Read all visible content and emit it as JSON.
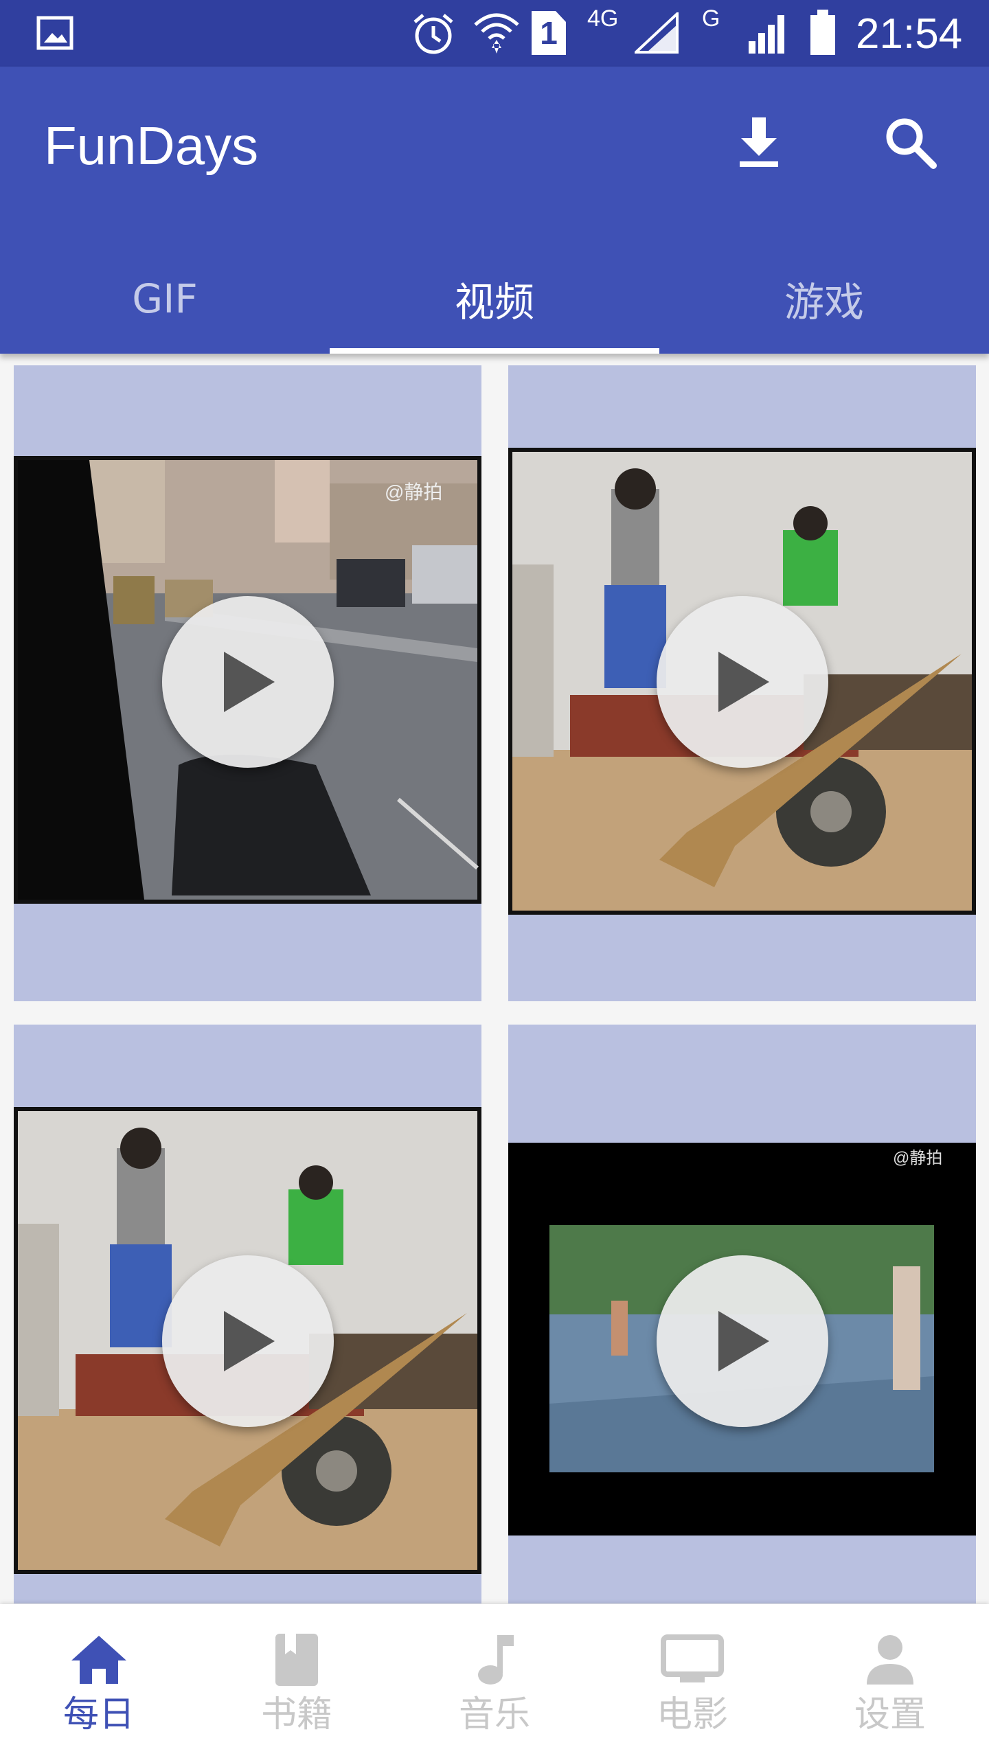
{
  "status_bar": {
    "time": "21:54",
    "network_4g": "4G",
    "network_g": "G",
    "sim_number": "1",
    "icons": [
      "gallery-icon",
      "alarm-icon",
      "wifi-icon",
      "sim-icon",
      "signal-icon",
      "signal-icon",
      "battery-icon"
    ]
  },
  "app_bar": {
    "title": "FunDays",
    "actions": [
      "download-icon",
      "search-icon"
    ]
  },
  "tabs": [
    {
      "label": "GIF",
      "active": false
    },
    {
      "label": "视频",
      "active": true
    },
    {
      "label": "游戏",
      "active": false
    }
  ],
  "videos": [
    {
      "scene": "street-from-car",
      "watermark": "@静拍"
    },
    {
      "scene": "boys-dancing-broom",
      "watermark": ""
    },
    {
      "scene": "boys-dancing-broom",
      "watermark": ""
    },
    {
      "scene": "square-fountain",
      "watermark": "@静拍"
    }
  ],
  "bottom_nav": [
    {
      "label": "每日",
      "icon": "home-icon",
      "active": true
    },
    {
      "label": "书籍",
      "icon": "book-icon",
      "active": false
    },
    {
      "label": "音乐",
      "icon": "music-note-icon",
      "active": false
    },
    {
      "label": "电影",
      "icon": "tv-icon",
      "active": false
    },
    {
      "label": "设置",
      "icon": "person-icon",
      "active": false
    }
  ],
  "colors": {
    "primary": "#3f51b5",
    "primary_dark": "#303f9f",
    "card_background": "#b9c0e0",
    "inactive_nav": "#c8c8c8"
  }
}
